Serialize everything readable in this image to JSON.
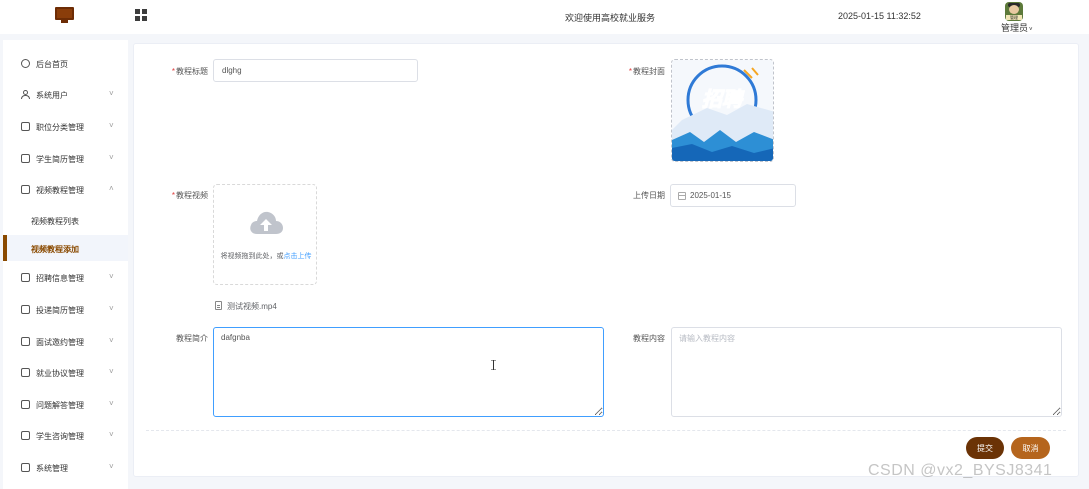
{
  "header": {
    "welcome": "欢迎使用高校就业服务",
    "datetime": "2025-01-15 11:32:52",
    "user": "管理员",
    "avatar_tag": "管理"
  },
  "sidebar": {
    "items": [
      {
        "label": "后台首页",
        "icon": "clock-icon"
      },
      {
        "label": "系统用户",
        "icon": "user-icon"
      },
      {
        "label": "职位分类管理",
        "icon": "folder-icon"
      },
      {
        "label": "学生简历管理",
        "icon": "folder-icon"
      },
      {
        "label": "视频教程管理",
        "icon": "folder-icon"
      },
      {
        "label": "招聘信息管理",
        "icon": "folder-icon"
      },
      {
        "label": "投递简历管理",
        "icon": "folder-icon"
      },
      {
        "label": "面试邀约管理",
        "icon": "folder-icon"
      },
      {
        "label": "就业协议管理",
        "icon": "folder-icon"
      },
      {
        "label": "问题解答管理",
        "icon": "folder-icon"
      },
      {
        "label": "学生咨询管理",
        "icon": "folder-icon"
      },
      {
        "label": "系统管理",
        "icon": "folder-icon"
      }
    ],
    "sub_items": [
      {
        "label": "视频教程列表"
      },
      {
        "label": "视频教程添加"
      }
    ]
  },
  "form": {
    "title_label": "教程标题",
    "title_value": "dlghg",
    "cover_label": "教程封面",
    "cover_image_text": "招聘",
    "video_label": "教程视频",
    "upload_hint": "将视频拖到此处，或",
    "upload_link": "点击上传",
    "file_name": "测试视频.mp4",
    "date_label": "上传日期",
    "date_value": "2025-01-15",
    "intro_label": "教程简介",
    "intro_value": "dafgnba",
    "content_label": "教程内容",
    "content_placeholder": "请输入教程内容",
    "submit": "提交",
    "cancel": "取消"
  },
  "watermark": "CSDN @vx2_BYSJ8341",
  "colors": {
    "accent": "#8a4a00",
    "submit": "#6b3306",
    "cancel": "#b5651d",
    "required": "#e03d3d",
    "link": "#409eff"
  }
}
